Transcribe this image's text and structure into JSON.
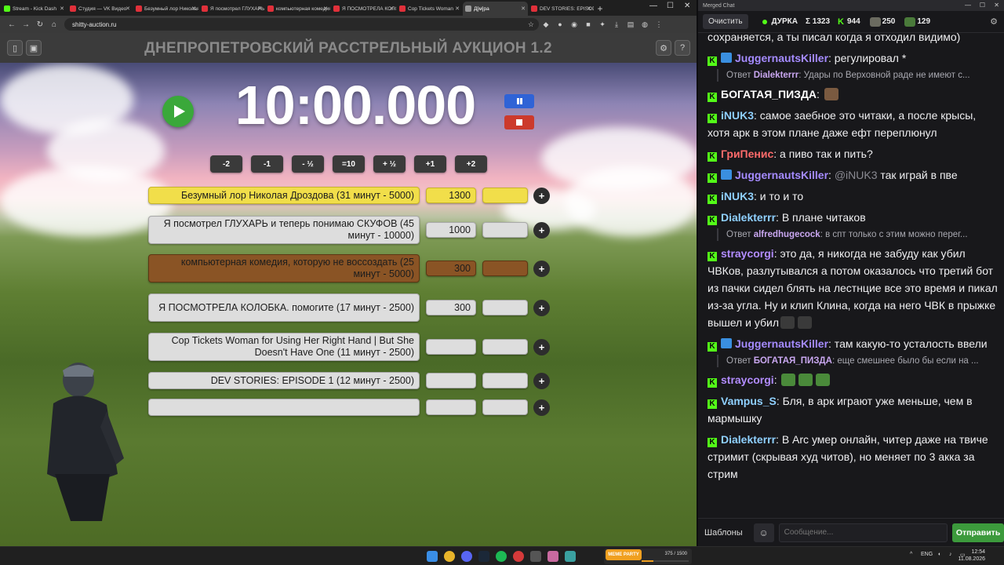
{
  "browser": {
    "tabs": [
      {
        "label": "Stream - Kick Dash",
        "color": "#53fc18"
      },
      {
        "label": "Студия — VK Видео",
        "color": "#e0303a"
      },
      {
        "label": "Безумный лор Николая",
        "color": "#e0303a"
      },
      {
        "label": "Я посмотрел ГЛУХАРЬ",
        "color": "#e0303a"
      },
      {
        "label": "компьютерная комедия",
        "color": "#e0303a"
      },
      {
        "label": "Я ПОСМОТРЕЛА КОЛОБКА",
        "color": "#e0303a"
      },
      {
        "label": "Cop Tickets Woman",
        "color": "#e0303a"
      },
      {
        "label": "Д[м]ра",
        "color": "#9a9a9a"
      },
      {
        "label": "DEV STORIES: EPISODE",
        "color": "#e0303a"
      }
    ],
    "url": "shitty-auction.ru"
  },
  "page": {
    "title": "ДНЕПРОПЕТРОВСКИЙ РАССТРЕЛЬНЫЙ АУКЦИОН 1.2",
    "timer": "10:00.000",
    "adjust_buttons": [
      "-2",
      "-1",
      "- ½",
      "=10",
      "+ ½",
      "+1",
      "+2"
    ],
    "lots": [
      {
        "name": "Безумный лор Николая Дроздова (31 минут - 5000)",
        "amount": "1300",
        "style": "yellow"
      },
      {
        "name": "Я посмотрел ГЛУХАРЬ и теперь понимаю СКУФОВ (45 минут - 10000)",
        "amount": "1000",
        "style": "gray"
      },
      {
        "name": "компьютерная комедия, которую не воссоздать (25 минут - 5000)",
        "amount": "300",
        "style": "brown"
      },
      {
        "name": "Я ПОСМОТРЕЛА КОЛОБКА. помогите (17 минут - 2500)",
        "amount": "300",
        "style": "gray"
      },
      {
        "name": "Cop Tickets Woman for Using Her Right Hand | But She Doesn't Have One (11 минут - 2500)",
        "amount": "",
        "style": "gray"
      },
      {
        "name": "DEV STORIES: EPISODE 1 (12 минут - 2500)",
        "amount": "",
        "style": "gray"
      },
      {
        "name": "",
        "amount": "",
        "style": "gray"
      }
    ],
    "add_label": "+"
  },
  "chat": {
    "window_title": "Merged Chat",
    "clear_label": "Очистить",
    "stream_name": "ДУРКА",
    "total": "Σ 1323",
    "kick_count": "944",
    "twitch_count": "250",
    "vk_count": "129",
    "top_partial": "сохраняется, а ты писал когда я отходил видимо)",
    "messages": [
      {
        "user": "JuggernautsKiller",
        "color": "#a58bff",
        "mod": true,
        "text": " регулировал *",
        "reply": {
          "user": "Dialekterrr",
          "text": " Удары по Верховной раде не имеют с..."
        }
      },
      {
        "user": "БОГАТАЯ_ПИЗДА",
        "color": "#ffffff",
        "mod": false,
        "text": " ",
        "emote": "#7a5a40"
      },
      {
        "user": "iNUK3",
        "color": "#8fd0ff",
        "mod": false,
        "text": " самое заебное это читаки, а после крысы, хотя арк в этом плане даже ефт переплюнул"
      },
      {
        "user": "ГриПенис",
        "color": "#ff6b6b",
        "mod": false,
        "text": " а пиво так и пить?"
      },
      {
        "user": "JuggernautsKiller",
        "color": "#a58bff",
        "mod": true,
        "mention": "@iNUK3",
        "text": " так играй в пве"
      },
      {
        "user": "iNUK3",
        "color": "#8fd0ff",
        "mod": false,
        "text": " и то и то"
      },
      {
        "user": "Dialekterrr",
        "color": "#8fd0ff",
        "mod": false,
        "text": " В плане читаков",
        "reply": {
          "user": "alfredhugecock",
          "text": " в спт только с этим можно перег..."
        }
      },
      {
        "user": "straycorgi",
        "color": "#b28cff",
        "mod": false,
        "text": " это да, я никогда не забуду как убил ЧВКов, разлутывался а потом оказалось что третий бот из пачки сидел блять на лестнцие все это время и пикал из-за угла. Ну и клип Клина, когда на него ЧВК в прыжке вышел и убил"
      },
      {
        "user": "JuggernautsKiller",
        "color": "#a58bff",
        "mod": true,
        "text": " там какую-то усталость ввели",
        "reply": {
          "user": "БОГАТАЯ_ПИЗДА",
          "text": " еще смешнее было бы если на ..."
        }
      },
      {
        "user": "straycorgi",
        "color": "#b28cff",
        "mod": false,
        "text": " "
      },
      {
        "user": "Vampus_S",
        "color": "#8fd0ff",
        "mod": false,
        "text": " Бля, в арк играют уже меньше, чем в мармышку"
      },
      {
        "user": "Dialekterrr",
        "color": "#8fd0ff",
        "mod": false,
        "text": " В Arc умер онлайн, читер даже на твиче стримит (скрывая худ читов), но меняет по 3 акка за стрим"
      }
    ],
    "reply_prefix": "Ответ",
    "templates_label": "Шаблоны",
    "input_placeholder": "Сообщение...",
    "send_label": "Отправить"
  },
  "taskbar": {
    "promo_label": "MEME PARTY",
    "promo_count": "375 / 1500",
    "promo_progress": 0.25,
    "lang": "ENG",
    "time": "12:54",
    "date": "11.08.2026"
  }
}
